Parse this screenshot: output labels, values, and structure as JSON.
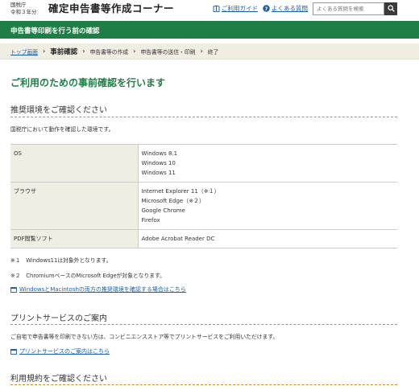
{
  "header": {
    "agency_line1": "国税庁",
    "agency_line2": "令和３年分",
    "title": "確定申告書等作成コーナー",
    "guide_link": "ご利用ガイド",
    "faq_link": "よくある質問",
    "search_placeholder": "よくある質問を検索"
  },
  "greenbar": {
    "title": "申告書等印刷を行う前の確認"
  },
  "steps": [
    "トップ画面",
    "事前確認",
    "申告書等の作成",
    "申告書等の送信・印刷",
    "終了"
  ],
  "main": {
    "page_title": "ご利用のための事前確認を行います",
    "section1": {
      "heading": "推奨環境をご確認ください",
      "intro": "国税庁において動作を確認した環境です。",
      "rows": [
        {
          "key": "OS",
          "values": [
            "Windows 8.1",
            "Windows 10",
            "Windows 11"
          ]
        },
        {
          "key": "ブラウザ",
          "values": [
            "Internet Explorer 11（※１）",
            "Microsoft Edge（※２）",
            "Google Chrome",
            "Firefox"
          ]
        },
        {
          "key": "PDF閲覧ソフト",
          "values": [
            "Adobe Acrobat Reader DC"
          ]
        }
      ],
      "note1": "※１　Windows11は対象外となります。",
      "note2": "※２　ChromiumベースのMicrosoft Edgeが対象となります。",
      "link": "WindowsとMacintoshの両方の推奨環境を確認する場合はこちら"
    },
    "section2": {
      "heading": "プリントサービスのご案内",
      "text": "ご自宅で申告書等を印刷できない方は、コンビニエンスストア等でプリントサービスをご利用いただけます。",
      "link": "プリントサービスのご案内はこちら"
    },
    "section3": {
      "heading": "利用規約をご確認ください"
    }
  }
}
